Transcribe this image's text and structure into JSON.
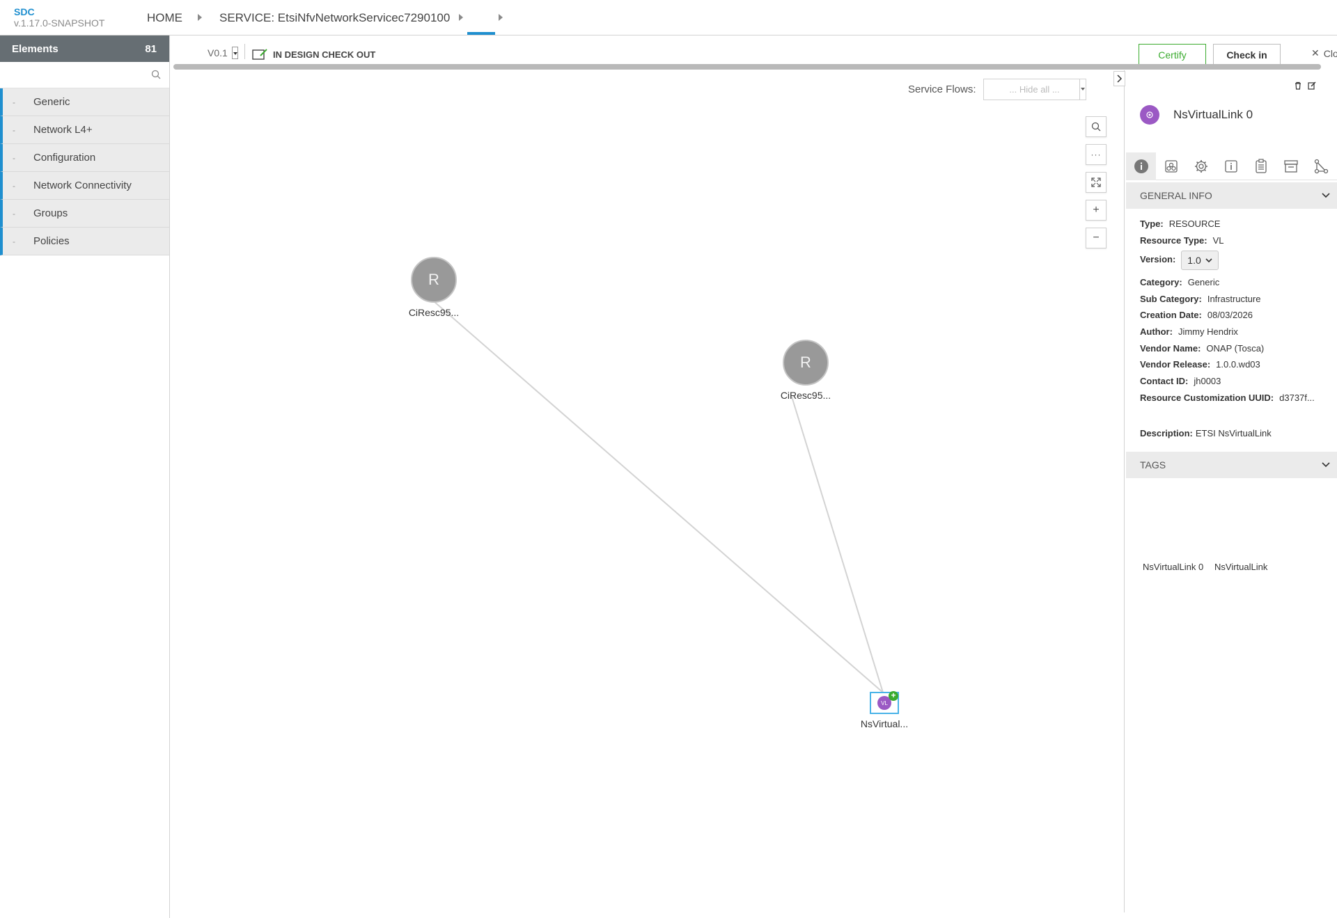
{
  "app": {
    "brand": "SDC",
    "version": "v.1.17.0-SNAPSHOT"
  },
  "breadcrumb": {
    "home": "HOME",
    "service": "SERVICE: EtsiNfvNetworkServicec7290100"
  },
  "palette": {
    "title": "Elements",
    "count": "81",
    "search_placeholder": "",
    "groups": [
      {
        "label": "Generic"
      },
      {
        "label": "Network L4+"
      },
      {
        "label": "Configuration"
      },
      {
        "label": "Network Connectivity"
      },
      {
        "label": "Groups"
      },
      {
        "label": "Policies"
      }
    ]
  },
  "toolbar": {
    "version": "V0.1",
    "state": "IN DESIGN CHECK OUT",
    "certify": "Certify",
    "checkin": "Check in",
    "close": "Close"
  },
  "canvas": {
    "service_flows_label": "Service Flows:",
    "service_flows_value": "... Hide all ...",
    "nodes": [
      {
        "letter": "R",
        "label": "CiResc95..."
      },
      {
        "letter": "R",
        "label": "CiResc95..."
      },
      {
        "badge": "VL",
        "label": "NsVirtual..."
      }
    ]
  },
  "details": {
    "title": "NsVirtualLink 0",
    "general_info_label": "GENERAL INFO",
    "fields": {
      "type": {
        "key": "Type:",
        "value": "RESOURCE"
      },
      "resource_type": {
        "key": "Resource Type:",
        "value": "VL"
      },
      "version": {
        "key": "Version:",
        "value": "1.0"
      },
      "category": {
        "key": "Category:",
        "value": "Generic"
      },
      "sub_category": {
        "key": "Sub Category:",
        "value": "Infrastructure"
      },
      "creation_date": {
        "key": "Creation Date:",
        "value": "08/03/2026"
      },
      "author": {
        "key": "Author:",
        "value": "Jimmy Hendrix"
      },
      "vendor_name": {
        "key": "Vendor Name:",
        "value": "ONAP (Tosca)"
      },
      "vendor_release": {
        "key": "Vendor Release:",
        "value": "1.0.0.wd03"
      },
      "contact_id": {
        "key": "Contact ID:",
        "value": "jh0003"
      },
      "customization_uuid": {
        "key": "Resource Customization UUID:",
        "value": "d3737f..."
      },
      "description": {
        "key": "Description:",
        "value": "ETSI NsVirtualLink"
      }
    },
    "tags_label": "TAGS",
    "tags": [
      "NsVirtualLink 0",
      "NsVirtualLink"
    ]
  },
  "colors": {
    "accent": "#1f8fcf",
    "certify": "#3bab2f",
    "vl_purple": "#9b59c4",
    "palette_header": "#666e73"
  }
}
